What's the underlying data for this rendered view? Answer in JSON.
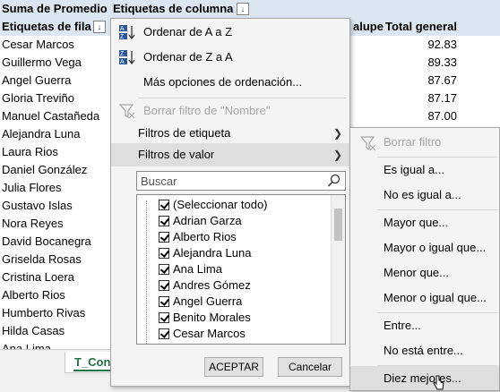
{
  "pivot": {
    "title": "Suma de Promedio",
    "column_labels_header": "Etiquetas de columna",
    "row_labels_header": "Etiquetas de fila",
    "column_partial": "alupe",
    "total_header": "Total general",
    "rows": [
      {
        "name": "Cesar Marcos",
        "total": "92.83"
      },
      {
        "name": "Guillermo Vega",
        "total": "89.33"
      },
      {
        "name": "Angel Guerra",
        "total": "87.67"
      },
      {
        "name": "Gloria Treviño",
        "total": "87.17"
      },
      {
        "name": "Manuel Castañeda",
        "total": "87.00"
      },
      {
        "name": "Alejandra Luna",
        "total": ""
      },
      {
        "name": "Laura Rios",
        "total": ""
      },
      {
        "name": "Daniel González",
        "total": ""
      },
      {
        "name": "Julia Flores",
        "total": ""
      },
      {
        "name": "Gustavo Islas",
        "total": ""
      },
      {
        "name": "Nora Reyes",
        "total": ""
      },
      {
        "name": "David Bocanegra",
        "total": ""
      },
      {
        "name": "Griselda Rosas",
        "total": ""
      },
      {
        "name": "Cristina Loera",
        "total": ""
      },
      {
        "name": "Alberto Rios",
        "total": ""
      },
      {
        "name": "Humberto Rivas",
        "total": ""
      },
      {
        "name": "Hilda Casas",
        "total": ""
      },
      {
        "name": "Ana Lima",
        "total": ""
      }
    ],
    "sheet_tab": "T_Con"
  },
  "menu": {
    "sort_az": "Ordenar de A a Z",
    "sort_za": "Ordenar de Z a A",
    "more_sort": "Más opciones de ordenación...",
    "clear_filter": "Borrar filtro de \"Nombre\"",
    "label_filters": "Filtros de etiqueta",
    "value_filters": "Filtros de valor",
    "search_placeholder": "Buscar",
    "list": [
      "(Seleccionar todo)",
      "Adrian Garza",
      "Alberto Rios",
      "Alejandra Luna",
      "Ana Lima",
      "Andres Gómez",
      "Angel Guerra",
      "Benito Morales",
      "Cesar Marcos"
    ],
    "ok": "ACEPTAR",
    "cancel": "Cancelar"
  },
  "submenu": {
    "clear": "Borrar filtro",
    "equals": "Es igual a...",
    "not_equals": "No es igual a...",
    "greater": "Mayor que...",
    "greater_eq": "Mayor o igual que...",
    "less": "Menor que...",
    "less_eq": "Menor o igual que...",
    "between": "Entre...",
    "not_between": "No está entre...",
    "top10": "Diez mejores..."
  },
  "icons": {
    "filter_dropdown": "filter-dropdown-icon",
    "sort_az": "sort-az-icon",
    "sort_za": "sort-za-icon",
    "clear_filter": "clear-filter-icon",
    "submenu_arrow": "chevron-right-icon",
    "search": "search-icon"
  }
}
